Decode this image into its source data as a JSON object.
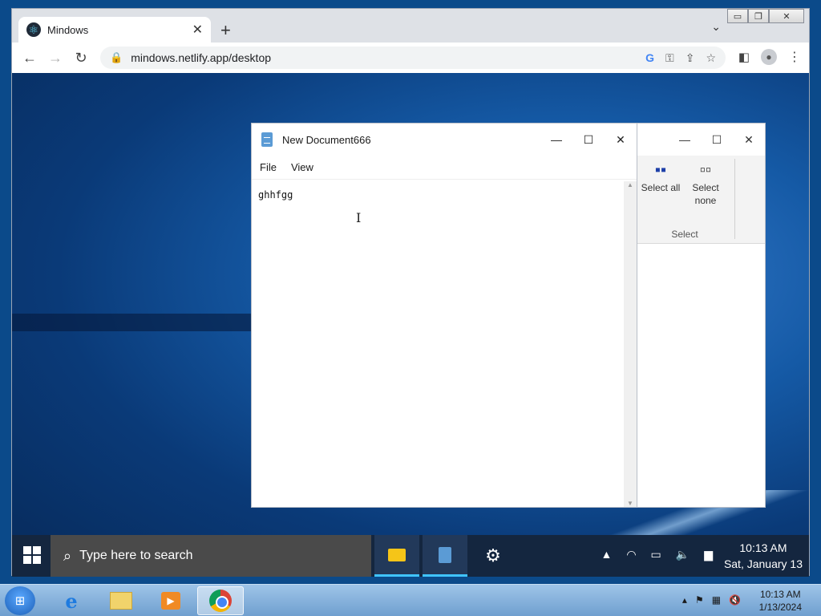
{
  "browser": {
    "tab_title": "Mindows",
    "url": "mindows.netlify.app/desktop"
  },
  "notepad": {
    "title": "New Document666",
    "menu": [
      "File",
      "View"
    ],
    "content": "ghhfgg"
  },
  "explorer": {
    "ribbon": {
      "select_all": "Select all",
      "select_none": "Select none",
      "group_label": "Select"
    }
  },
  "mindows_taskbar": {
    "search_placeholder": "Type here to search",
    "time": "10:13 AM",
    "date": "Sat, January 13"
  },
  "win7_taskbar": {
    "time": "10:13 AM",
    "date": "1/13/2024"
  }
}
